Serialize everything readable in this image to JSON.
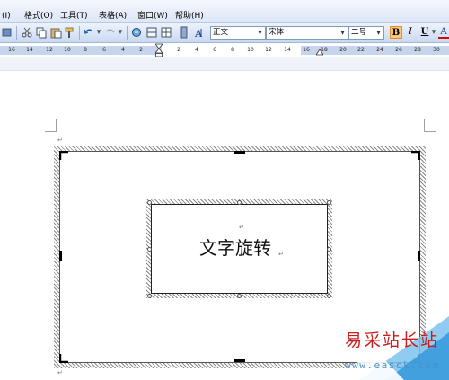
{
  "menu": {
    "items": [
      {
        "label": "(I)"
      },
      {
        "label": "格式(O)"
      },
      {
        "label": "工具(T)"
      },
      {
        "label": "表格(A)"
      },
      {
        "label": "窗口(W)"
      },
      {
        "label": "帮助(H)"
      }
    ]
  },
  "toolbar": {
    "style_value": "正文",
    "font_value": "宋体",
    "size_value": "二号",
    "bold_label": "B",
    "italic_label": "I",
    "underline_label": "U",
    "font_color_label": "A",
    "colors": {
      "active": "#ffc77a",
      "accent": "#dde7f7"
    }
  },
  "ruler": {
    "numbers": [
      "16",
      "14",
      "12",
      "10",
      "8",
      "6",
      "4",
      "2",
      "2",
      "4",
      "6",
      "8",
      "10",
      "12",
      "14",
      "16",
      "18",
      "20",
      "22",
      "24",
      "26",
      "28",
      "30"
    ]
  },
  "document": {
    "text_box_text": "文字旋转",
    "paragraph_mark": "↵"
  },
  "watermark": {
    "site_name": "易采站长站",
    "url": "www.easck.com"
  }
}
